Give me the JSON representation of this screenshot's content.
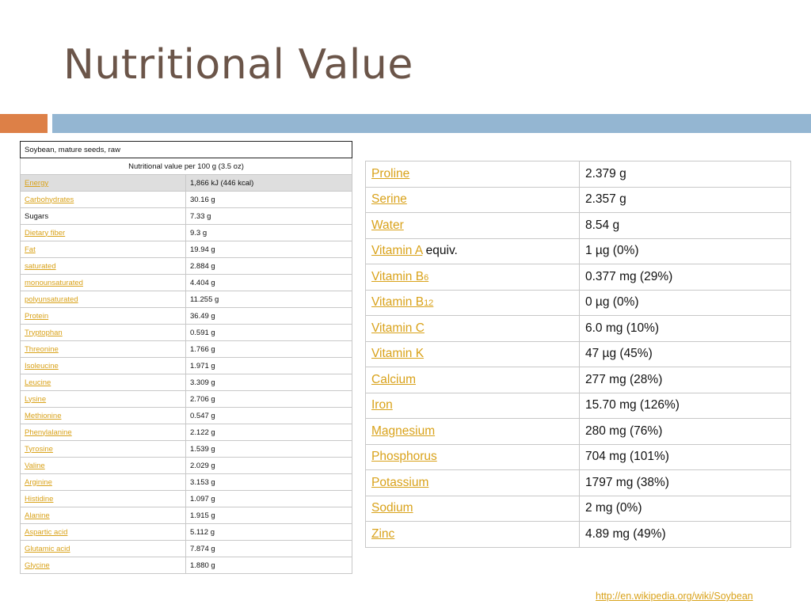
{
  "title": "Nutritional Value",
  "accent_colors": {
    "orange": "#dd8047",
    "blue": "#94b6d2",
    "link": "#d9a21a",
    "title": "#6b5549"
  },
  "left_table": {
    "caption": "Soybean, mature seeds, raw",
    "subheader": "Nutritional value per 100 g (3.5 oz)",
    "rows": [
      {
        "name": "Energy",
        "value": "1,866 kJ (446 kcal)",
        "link": true,
        "highlight": true
      },
      {
        "name": "Carbohydrates",
        "value": "30.16 g",
        "link": true
      },
      {
        "name": "Sugars",
        "value": "7.33 g",
        "link": false
      },
      {
        "name": "Dietary fiber",
        "value": "9.3 g",
        "link": true
      },
      {
        "name": "Fat",
        "value": "19.94 g",
        "link": true
      },
      {
        "name": "saturated",
        "value": "2.884 g",
        "link": true
      },
      {
        "name": "monounsaturated",
        "value": "4.404 g",
        "link": true
      },
      {
        "name": "polyunsaturated",
        "value": "11.255 g",
        "link": true
      },
      {
        "name": "Protein",
        "value": "36.49 g",
        "link": true
      },
      {
        "name": "Tryptophan",
        "value": "0.591 g",
        "link": true
      },
      {
        "name": "Threonine",
        "value": "1.766 g",
        "link": true
      },
      {
        "name": "Isoleucine",
        "value": "1.971 g",
        "link": true
      },
      {
        "name": "Leucine",
        "value": "3.309 g",
        "link": true
      },
      {
        "name": "Lysine",
        "value": "2.706 g",
        "link": true
      },
      {
        "name": "Methionine",
        "value": "0.547 g",
        "link": true
      },
      {
        "name": "Phenylalanine",
        "value": "2.122 g",
        "link": true
      },
      {
        "name": "Tyrosine",
        "value": "1.539 g",
        "link": true
      },
      {
        "name": "Valine",
        "value": "2.029 g",
        "link": true
      },
      {
        "name": "Arginine",
        "value": "3.153 g",
        "link": true
      },
      {
        "name": "Histidine",
        "value": "1.097 g",
        "link": true
      },
      {
        "name": "Alanine",
        "value": "1.915 g",
        "link": true
      },
      {
        "name": "Aspartic acid",
        "value": "5.112 g",
        "link": true
      },
      {
        "name": "Glutamic acid",
        "value": "7.874 g",
        "link": true
      },
      {
        "name": "Glycine",
        "value": "1.880 g",
        "link": true
      }
    ]
  },
  "right_table": {
    "rows": [
      {
        "name": "Proline",
        "value": "2.379 g"
      },
      {
        "name": "Serine",
        "value": "2.357 g"
      },
      {
        "name": "Water",
        "value": "8.54 g"
      },
      {
        "name": "Vitamin A",
        "suffix": " equiv.",
        "value": "1 µg (0%)"
      },
      {
        "name": "Vitamin B",
        "sub": "6",
        "value": "0.377 mg (29%)"
      },
      {
        "name": "Vitamin B",
        "sub": "12",
        "value": "0 µg (0%)"
      },
      {
        "name": "Vitamin C",
        "value": "6.0 mg (10%)"
      },
      {
        "name": "Vitamin K",
        "value": "47 µg (45%)"
      },
      {
        "name": "Calcium",
        "value": "277 mg (28%)"
      },
      {
        "name": "Iron",
        "value": "15.70 mg (126%)"
      },
      {
        "name": "Magnesium",
        "value": "280 mg (76%)"
      },
      {
        "name": "Phosphorus",
        "value": "704 mg (101%)"
      },
      {
        "name": "Potassium",
        "value": "1797 mg (38%)"
      },
      {
        "name": "Sodium",
        "value": "2 mg (0%)"
      },
      {
        "name": "Zinc",
        "value": "4.89 mg (49%)"
      }
    ]
  },
  "source_link": "http://en.wikipedia.org/wiki/Soybean"
}
